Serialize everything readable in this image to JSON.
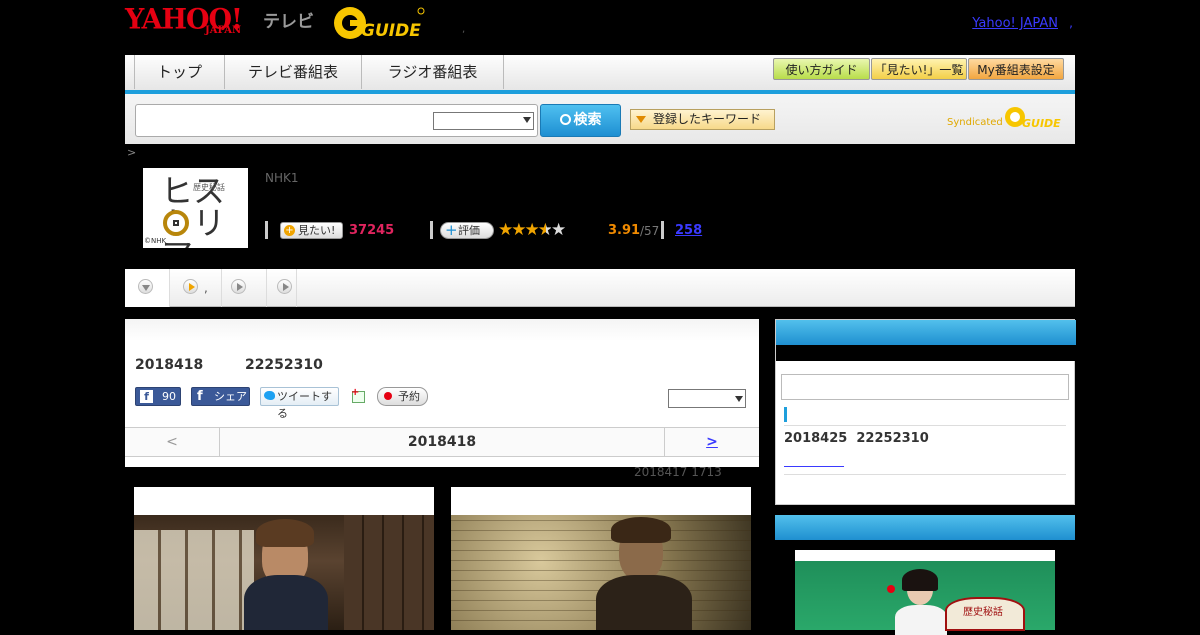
{
  "header": {
    "yahoo_logo": "YAHOO!",
    "yahoo_japan": "JAPAN",
    "tv_label": "テレビ",
    "gguide_logo": "G GUIDE",
    "yahoo_japan_link": "Yahoo! JAPAN",
    "comma": ",",
    "dot": ","
  },
  "nav": {
    "tabs": [
      "トップ",
      "テレビ番組表",
      "ラジオ番組表"
    ],
    "right_buttons": [
      "使い方ガイド",
      "「見たい!」一覧",
      "My番組表設定"
    ]
  },
  "search": {
    "placeholder": "",
    "select_value": "",
    "button_label": "検索",
    "keyword_button": "登録したキーワード",
    "syndicated": "Syndicated"
  },
  "breadcrumb": ">",
  "program": {
    "thumb_title": "ヒストリア",
    "thumb_sub": "歴史秘話",
    "thumb_copyright": "©NHK",
    "channel": "NHK1",
    "mitai_label": "見たい!",
    "mitai_count": "37245",
    "rating_button": "評価",
    "rating": 3.91,
    "rating_value": "3.91",
    "rating_count": "/57",
    "comments_link": "258"
  },
  "subtabs": [
    {
      "label": ""
    },
    {
      "label": ","
    },
    {
      "label": ""
    },
    {
      "label": ""
    }
  ],
  "main": {
    "date": "2018418",
    "time": "22252310",
    "fb_count": "90",
    "fb_share": "シェア",
    "tweet": "ツイートする",
    "reserve": "予約",
    "select_value": "",
    "prev": "<",
    "center_date": "2018418",
    "next": ">",
    "updated": "2018417  1713"
  },
  "side": {
    "next_date": "2018425",
    "next_time": "22252310",
    "link_text": "　　　　　"
  },
  "colors": {
    "accent_blue": "#1e9fdc",
    "yahoo_red": "#e60012",
    "gguide_yellow": "#f7c600",
    "mitai_pink": "#e0245e",
    "rating_orange": "#f08a00"
  }
}
